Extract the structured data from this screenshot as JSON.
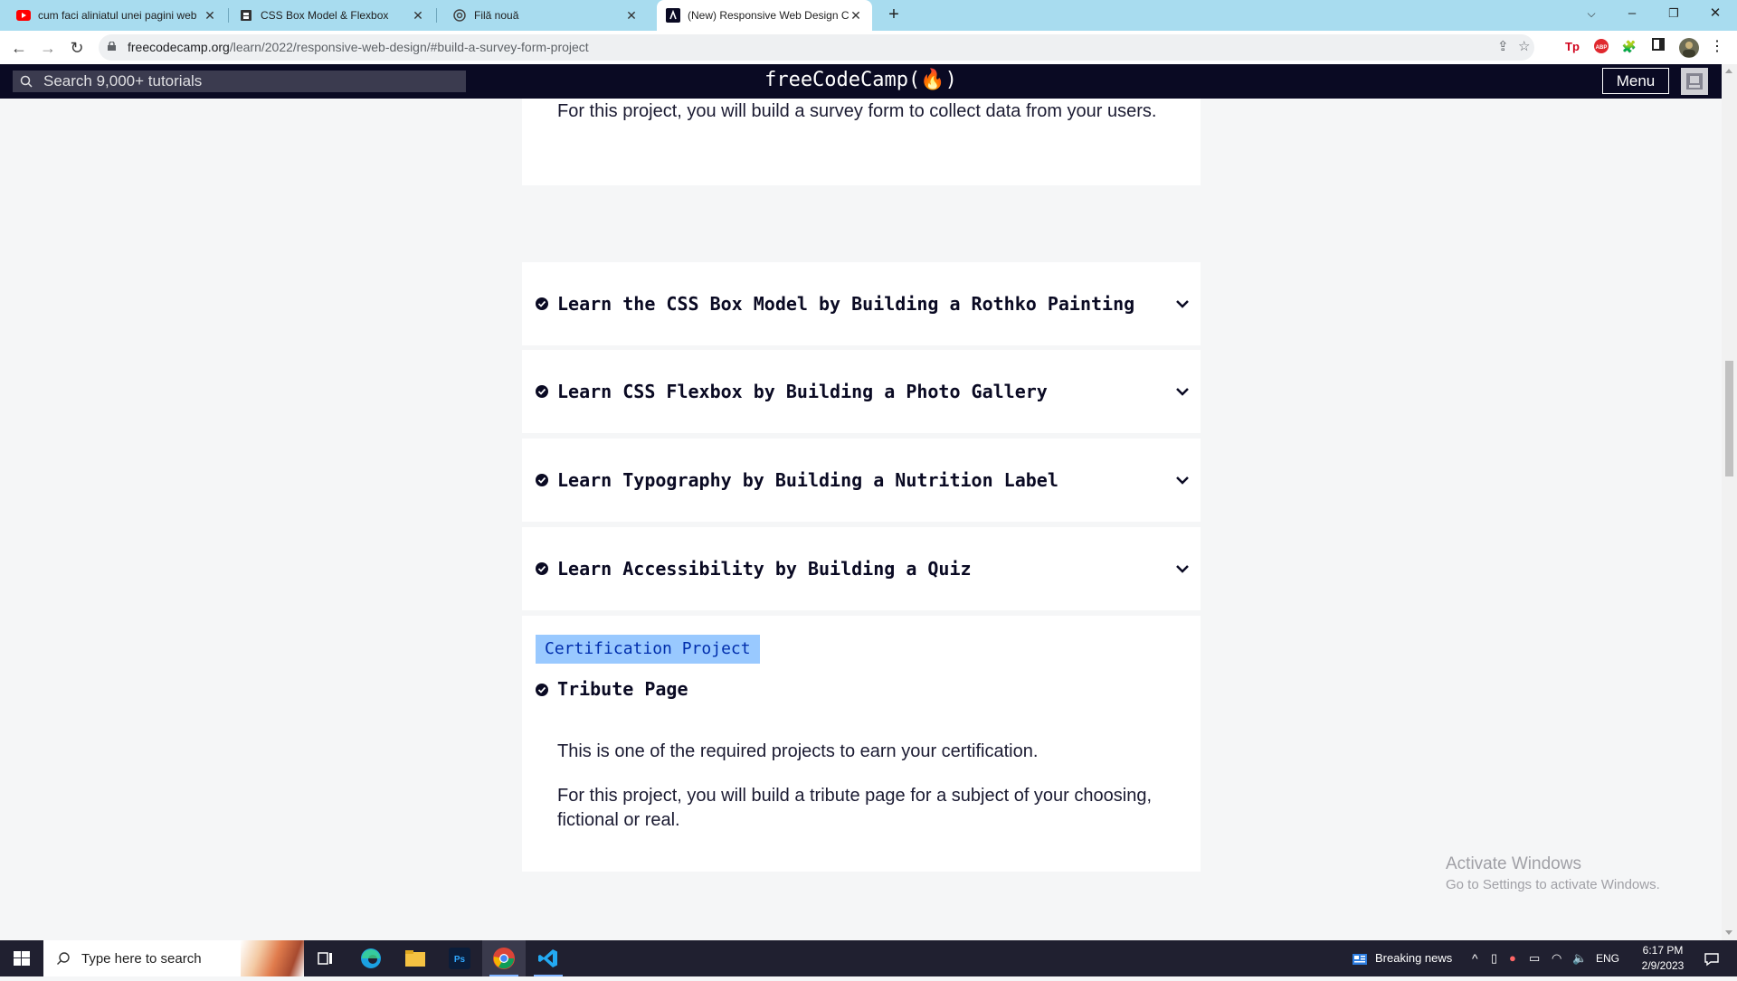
{
  "browser": {
    "tabs": [
      {
        "title": "cum faci aliniatul unei pagini web",
        "icon": "youtube-icon"
      },
      {
        "title": "CSS Box Model & Flexbox",
        "icon": "page-icon"
      },
      {
        "title": "Filă nouă",
        "icon": "chrome-icon"
      },
      {
        "title": "(New) Responsive Web Design Certification",
        "icon": "freecodecamp-icon"
      }
    ],
    "active_tab": 3,
    "url_host": "freecodecamp.org",
    "url_path": "/learn/2022/responsive-web-design/#build-a-survey-form-project"
  },
  "fcc_nav": {
    "search_placeholder": "Search 9,000+ tutorials",
    "logo": "freeCodeCamp(🔥)",
    "menu_label": "Menu"
  },
  "content": {
    "survey_text": "For this project, you will build a survey form to collect data from your users.",
    "blocks": [
      {
        "title": "Learn the CSS Box Model by Building a Rothko Painting",
        "completed": true
      },
      {
        "title": "Learn CSS Flexbox by Building a Photo Gallery",
        "completed": true
      },
      {
        "title": "Learn Typography by Building a Nutrition Label",
        "completed": true
      },
      {
        "title": "Learn Accessibility by Building a Quiz",
        "completed": true
      }
    ],
    "cert_badge": "Certification Project",
    "tribute_title": "Tribute Page",
    "tribute_p1": "This is one of the required projects to earn your certification.",
    "tribute_p2": "For this project, you will build a tribute page for a subject of your choosing, fictional or real."
  },
  "watermark": {
    "title": "Activate Windows",
    "subtitle": "Go to Settings to activate Windows."
  },
  "taskbar": {
    "search_placeholder": "Type here to search",
    "news": "Breaking news",
    "lang": "ENG",
    "time": "6:17 PM",
    "date": "2/9/2023"
  }
}
